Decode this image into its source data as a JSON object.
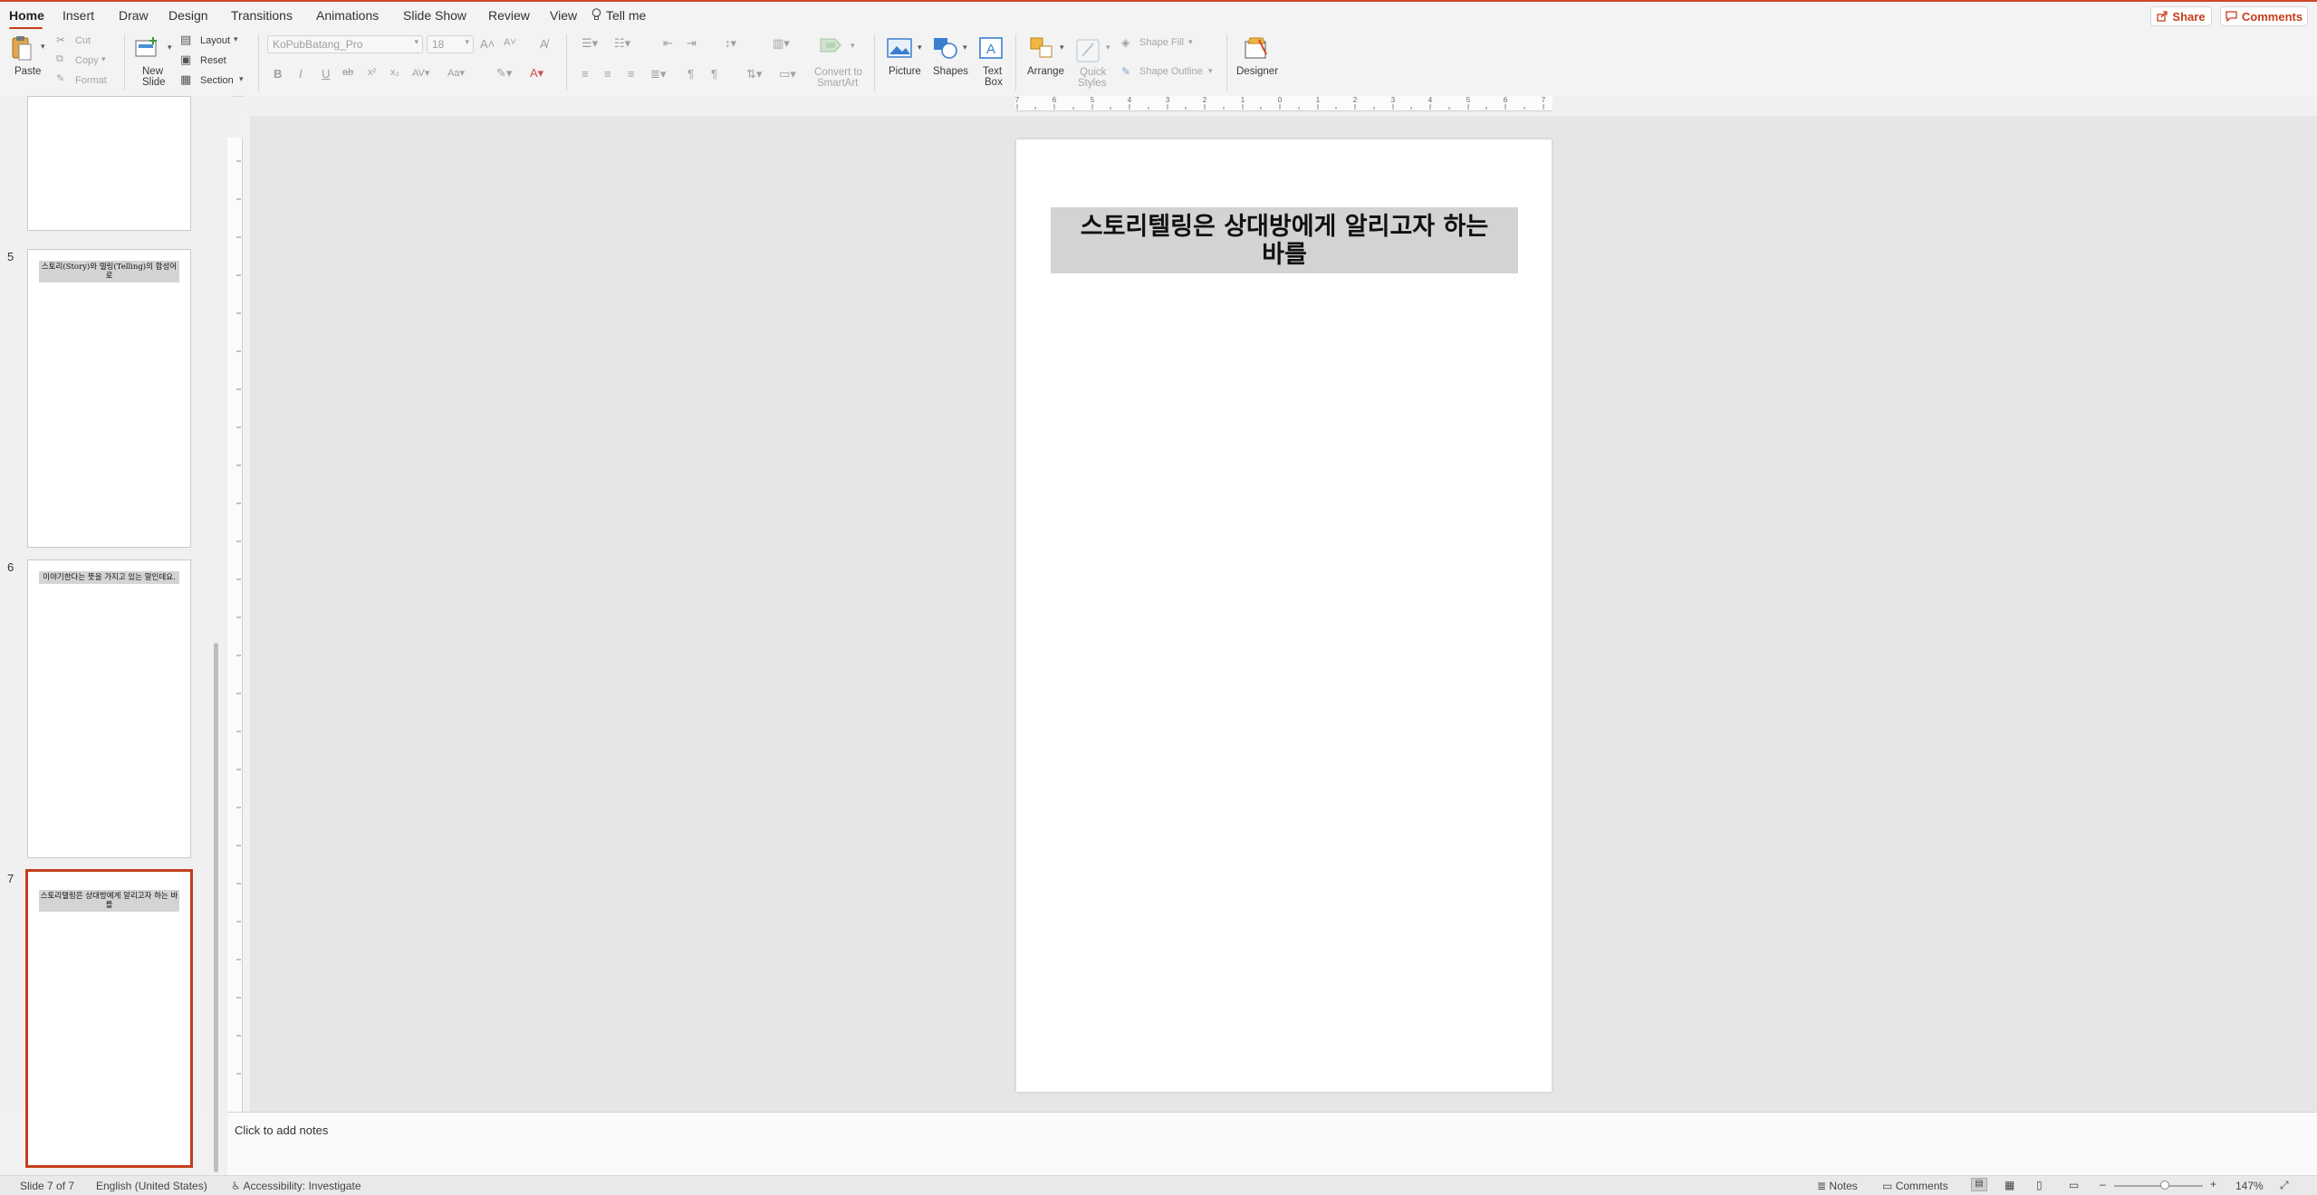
{
  "tabs": [
    {
      "label": "Home",
      "active": true
    },
    {
      "label": "Insert"
    },
    {
      "label": "Draw"
    },
    {
      "label": "Design"
    },
    {
      "label": "Transitions"
    },
    {
      "label": "Animations"
    },
    {
      "label": "Slide Show"
    },
    {
      "label": "Review"
    },
    {
      "label": "View"
    }
  ],
  "tell_me": "Tell me",
  "share_label": "Share",
  "comments_label": "Comments",
  "ribbon": {
    "paste": "Paste",
    "cut": "Cut",
    "copy": "Copy",
    "format": "Format",
    "new_slide_1": "New",
    "new_slide_2": "Slide",
    "layout": "Layout",
    "reset": "Reset",
    "section": "Section",
    "font_name": "KoPubBatang_Pro",
    "font_size": "18",
    "convert_1": "Convert to",
    "convert_2": "SmartArt",
    "picture": "Picture",
    "shapes": "Shapes",
    "textbox_1": "Text",
    "textbox_2": "Box",
    "arrange": "Arrange",
    "quick_1": "Quick",
    "quick_2": "Styles",
    "shape_fill": "Shape Fill",
    "shape_outline": "Shape Outline",
    "designer": "Designer"
  },
  "thumbnails": [
    {
      "num": "",
      "title": ""
    },
    {
      "num": "5",
      "title": "스토리(Story)와 텔링(Telling)의 합성어로"
    },
    {
      "num": "6",
      "title": "이야기한다는 뜻을 가지고 있는 말인데요."
    },
    {
      "num": "7",
      "title": "스토리텔링은 상대방에게 알리고자 하는 바를"
    }
  ],
  "slide": {
    "title": "스토리텔링은 상대방에게 알리고자 하는 바를"
  },
  "notes_placeholder": "Click to add notes",
  "status": {
    "slide_count": "Slide 7 of 7",
    "language": "English (United States)",
    "accessibility": "Accessibility: Investigate",
    "notes": "Notes",
    "comments": "Comments",
    "zoom": "147%"
  },
  "colors": {
    "accent": "#c43e1c",
    "selected_border": "#c43e1c"
  }
}
